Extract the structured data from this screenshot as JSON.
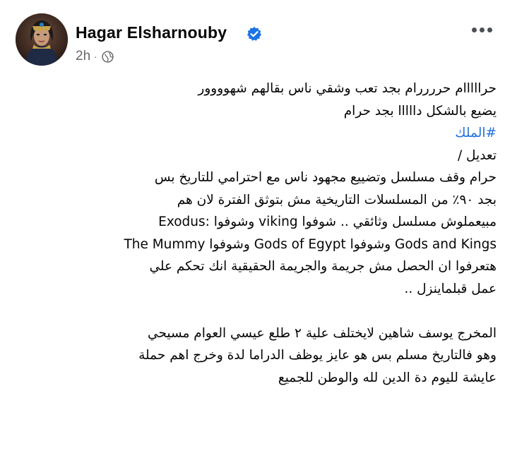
{
  "post": {
    "author": {
      "name": "Hagar Elsharnouby",
      "verified": true,
      "avatar_icon": "avatar-portrait"
    },
    "timestamp": "2h",
    "separator": "·",
    "audience_icon": "globe-icon",
    "more_icon": "more-options-icon",
    "body_lines": [
      "حرااااام حررررام بجد تعب وشقي ناس بقالهم شهوووور",
      "يضيع بالشكل  دااااا بجد حرام",
      "#الملك",
      "تعديل /",
      "حرام وقف مسلسل وتضييع مجهود ناس مع احترامي للتاريخ بس",
      "بجد ٩٠٪ من المسلسلات التاريخية مش بتوثق الفترة لان هم",
      "مبيعملوش مسلسل  وثائقي .. شوفوا viking وشوفوا :Exodus",
      "Gods and Kings وشوفوا Gods of Egypt وشوفوا The Mummy",
      "هتعرفوا ان الحصل مش جريمة والجريمة الحقيقية انك تحكم علي",
      "عمل قبلماينزل ..",
      "",
      "المخرج يوسف شاهين لايختلف علية ٢ طلع عيسي العوام مسيحي",
      "وهو فالتاريخ مسلم بس هو عايز يوظف الدراما لدة وخرج اهم حملة",
      "عايشة لليوم دة الدين لله والوطن للجميع"
    ]
  },
  "colors": {
    "text": "#050505",
    "secondary": "#65676b",
    "link": "#216fdb",
    "verified": "#1b74e4"
  }
}
